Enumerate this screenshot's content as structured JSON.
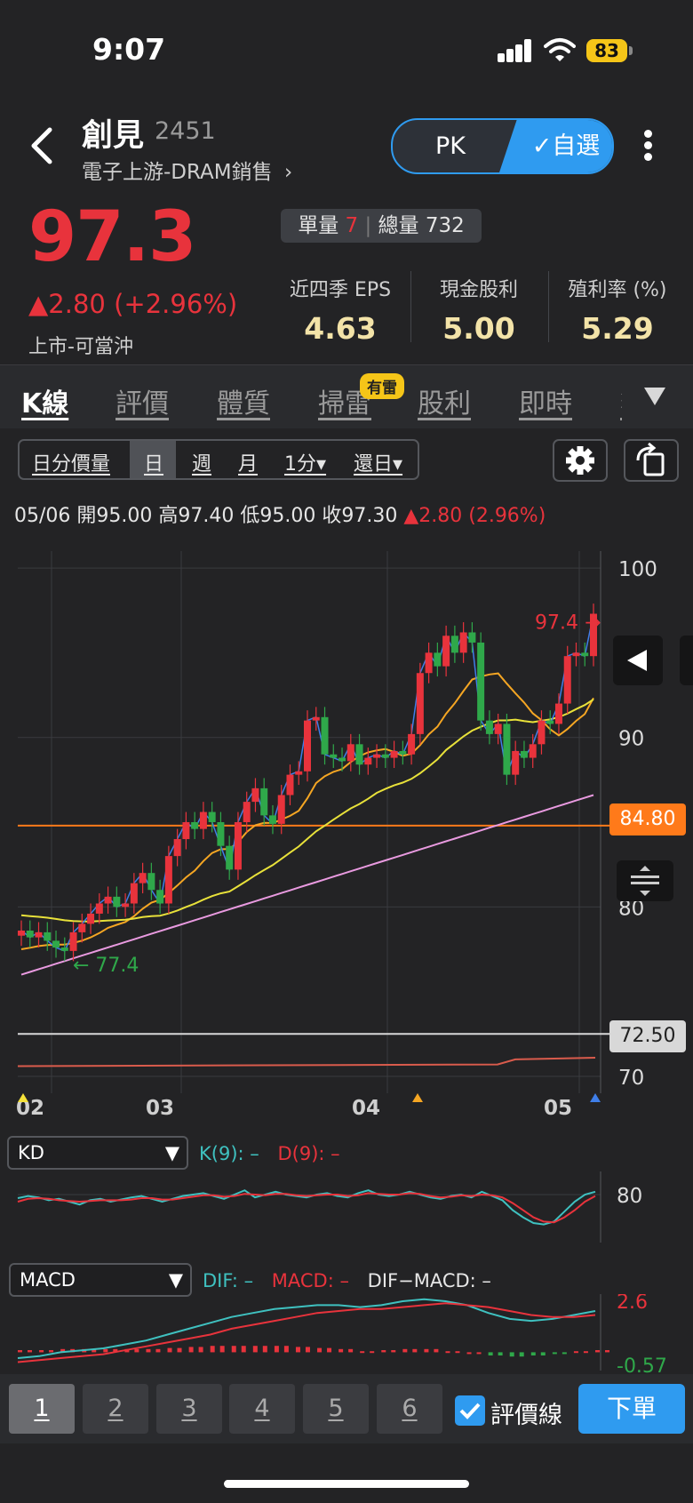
{
  "status_bar": {
    "time": "9:07",
    "battery": "83"
  },
  "header": {
    "name": "創見",
    "code": "2451",
    "industry": "電子上游-DRAM銷售",
    "pk_label": "PK",
    "favorite_label": "✓自選"
  },
  "quote": {
    "price": "97.3",
    "change": "▲2.80 (+2.96%)",
    "market": "上市-可當沖",
    "unit_vol_label": "單量",
    "unit_vol": "7",
    "total_vol_label": "總量 732",
    "stats": [
      {
        "label": "近四季 EPS",
        "value": "4.63"
      },
      {
        "label": "現金股利",
        "value": "5.00"
      },
      {
        "label": "殖利率 (%)",
        "value": "5.29"
      }
    ]
  },
  "tabs": [
    "K線",
    "評價",
    "體質",
    "掃雷",
    "股利",
    "即時",
    "籌"
  ],
  "hot_badge": "有雷",
  "chart_toolbar": {
    "periods": [
      "日分價量",
      "日",
      "週",
      "月",
      "1分▾",
      "還日▾"
    ],
    "active": "日"
  },
  "ohlc": {
    "date": "05/06",
    "open": "開95.00",
    "high": "高97.40",
    "low": "低95.00",
    "close": "收97.30",
    "change": "▲2.80 (2.96%)"
  },
  "price_tags": {
    "line1": "84.80",
    "line2": "72.50"
  },
  "colors": {
    "up": "#e8333c",
    "down": "#2fa84a",
    "accent": "#2f9bf0",
    "orange_line": "#ff7a1a"
  },
  "chart_data": [
    {
      "type": "line",
      "title": "",
      "x_ticks": [
        "02",
        "03",
        "04",
        "05"
      ],
      "y_ticks": [
        100,
        90,
        80,
        70
      ],
      "ylim": [
        69,
        101
      ],
      "annotations": {
        "high": "97.4",
        "low": "77.4"
      },
      "series": [],
      "candles_close": [
        78.6,
        78.2,
        78.5,
        78.0,
        77.6,
        77.4,
        78.5,
        79.0,
        79.6,
        80.2,
        80.6,
        80.0,
        80.2,
        81.4,
        82.0,
        81.0,
        80.2,
        83.0,
        84.0,
        85.0,
        84.6,
        85.6,
        85.0,
        83.6,
        82.2,
        85.0,
        86.2,
        87.0,
        85.4,
        84.9,
        86.6,
        87.8,
        88.0,
        91.0,
        91.2,
        89.0,
        88.8,
        88.6,
        89.6,
        88.4,
        88.8,
        89.0,
        88.8,
        89.2,
        89.0,
        90.2,
        93.8,
        95.0,
        94.2,
        96.0,
        95.0,
        96.2,
        95.6,
        91.0,
        90.2,
        90.8,
        87.8,
        89.2,
        88.8,
        89.6,
        91.0,
        90.8,
        92.0,
        94.8,
        95.0,
        94.8,
        97.3
      ]
    },
    {
      "type": "line",
      "title": "KD",
      "y_ticks": [
        80
      ],
      "series": [
        {
          "name": "K(9):",
          "values": [
            75,
            78,
            76,
            72,
            74,
            70,
            66,
            72,
            74,
            70,
            73,
            76,
            78,
            74,
            70,
            74,
            78,
            80,
            82,
            78,
            74,
            80,
            86,
            76,
            80,
            84,
            80,
            78,
            76,
            80,
            82,
            78,
            76,
            82,
            86,
            80,
            78,
            80,
            84,
            80,
            76,
            74,
            78,
            80,
            76,
            84,
            78,
            72,
            58,
            48,
            40,
            38,
            42,
            56,
            70,
            80,
            84
          ]
        },
        {
          "name": "D(9):",
          "values": [
            70,
            74,
            75,
            74,
            72,
            71,
            70,
            71,
            72,
            72,
            72,
            73,
            75,
            75,
            73,
            73,
            75,
            77,
            79,
            79,
            77,
            78,
            81,
            80,
            79,
            81,
            81,
            79,
            78,
            79,
            80,
            80,
            78,
            79,
            82,
            81,
            80,
            80,
            82,
            81,
            78,
            76,
            77,
            79,
            78,
            80,
            79,
            76,
            68,
            58,
            48,
            42,
            41,
            48,
            58,
            70,
            78
          ]
        }
      ]
    },
    {
      "type": "line",
      "title": "MACD",
      "y_ticks": [
        2.6,
        -0.57
      ],
      "series": [
        {
          "name": "DIF:",
          "values": [
            -0.3,
            -0.2,
            0.0,
            0.1,
            0.2,
            0.4,
            0.6,
            0.9,
            1.2,
            1.5,
            1.8,
            2.0,
            2.2,
            2.3,
            2.4,
            2.4,
            2.3,
            2.4,
            2.6,
            2.7,
            2.6,
            2.4,
            2.0,
            1.7,
            1.6,
            1.7,
            1.9,
            2.1
          ]
        },
        {
          "name": "MACD:",
          "values": [
            -0.5,
            -0.4,
            -0.3,
            -0.2,
            -0.1,
            0.1,
            0.3,
            0.5,
            0.7,
            0.9,
            1.2,
            1.4,
            1.6,
            1.8,
            2.0,
            2.1,
            2.2,
            2.2,
            2.3,
            2.4,
            2.5,
            2.4,
            2.3,
            2.1,
            1.9,
            1.8,
            1.8,
            1.9
          ]
        }
      ],
      "extra_legend": "DIF−MACD:"
    }
  ],
  "indicators": {
    "kd": {
      "name": "KD",
      "k_label": "K(9):",
      "k_val": "–",
      "d_label": "D(9):",
      "d_val": "–"
    },
    "macd": {
      "name": "MACD",
      "dif_label": "DIF:",
      "dif_val": "–",
      "macd_label": "MACD:",
      "macd_val": "–",
      "osc_label": "DIF−MACD:",
      "osc_val": "–"
    }
  },
  "bottom_bar": {
    "layouts": [
      "1",
      "2",
      "3",
      "4",
      "5",
      "6"
    ],
    "valuation_label": "評價線",
    "order_label": "下單"
  }
}
